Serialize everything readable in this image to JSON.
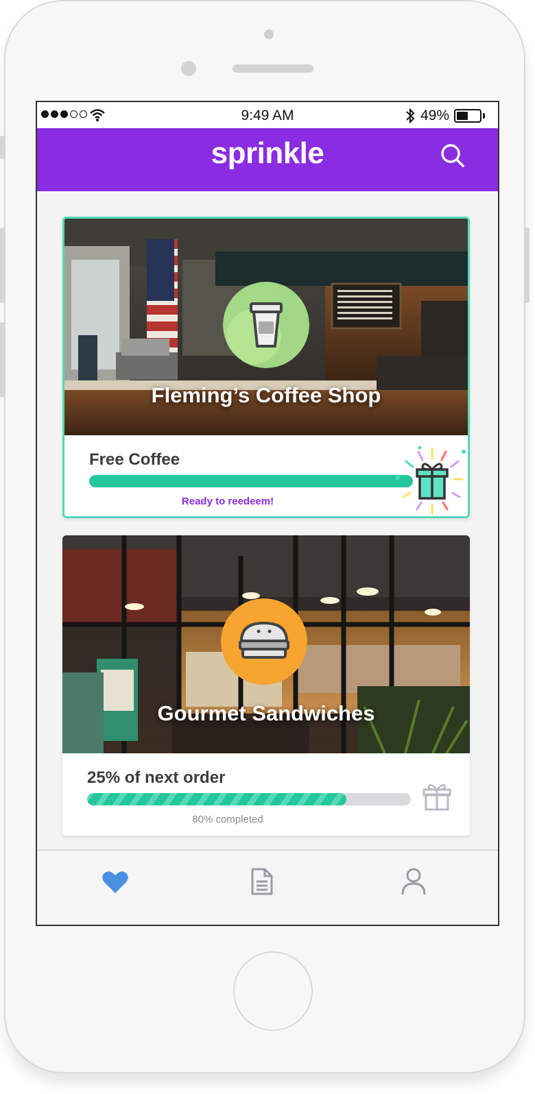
{
  "statusbar": {
    "time": "9:49 AM",
    "battery_pct": "49%",
    "battery_level": 0.49,
    "signal_bars": 3,
    "signal_total": 5,
    "icons": [
      "signal-dots-icon",
      "wifi-icon",
      "bluetooth-icon",
      "battery-icon"
    ]
  },
  "appbar": {
    "brand": "sprinkle",
    "search_icon": "search-icon",
    "color": "#8a2ce2"
  },
  "cards": [
    {
      "shop": "Fleming’s Coffee Shop",
      "badge_icon": "coffee-cup-icon",
      "badge_color": "#a8e08a",
      "reward": "Free Coffee",
      "progress": 1.0,
      "note": "Ready to reedeem!",
      "gift_icon": "gift-icon-active",
      "highlight_color": "#52d8bb"
    },
    {
      "shop": "Gourmet Sandwiches",
      "badge_icon": "sandwich-icon",
      "badge_color": "#f7a530",
      "reward": "25% of next order",
      "progress": 0.8,
      "note": "80% completed",
      "gift_icon": "gift-icon-inactive"
    }
  ],
  "tabbar": {
    "tabs": [
      {
        "name": "favorites",
        "icon": "heart-icon",
        "active": true,
        "color": "#4a90e2"
      },
      {
        "name": "orders",
        "icon": "document-icon",
        "active": false
      },
      {
        "name": "profile",
        "icon": "user-icon",
        "active": false
      }
    ]
  },
  "colors": {
    "progress": "#23c79b",
    "accent": "#8a2ce2"
  }
}
